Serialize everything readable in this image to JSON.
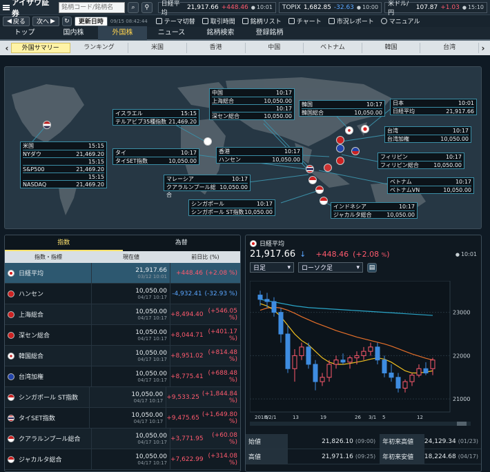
{
  "header": {
    "brand": "アイザワ証券",
    "search_placeholder": "銘柄コード/銘柄名",
    "indices": [
      {
        "name": "日経平均",
        "value": "21,917.66",
        "change": "+448.46",
        "time": "10:01",
        "dir": "up"
      },
      {
        "name": "TOPIX",
        "value": "1,682.85",
        "change": "-32.63",
        "time": "10:00",
        "dir": "dn"
      },
      {
        "name": "米ドル/円",
        "value": "107.87",
        "change": "+1.03",
        "time": "15:10",
        "dir": "up"
      }
    ]
  },
  "bar2": {
    "back": "戻る",
    "next": "次へ",
    "update": "更新日時",
    "stamp": "09/15 08:42:44",
    "tools": [
      "テーマ切替",
      "取引時間",
      "銘柄リスト",
      "チャート",
      "市況レポート",
      "マニュアル"
    ]
  },
  "maintabs": [
    "トップ",
    "国内株",
    "外国株",
    "ニュース",
    "銘柄検索",
    "登録銘柄"
  ],
  "subtabs": [
    "外国サマリー",
    "ランキング",
    "米国",
    "香港",
    "中国",
    "ベトナム",
    "韓国",
    "台湾"
  ],
  "map": {
    "boxes": [
      {
        "id": "china",
        "rows": [
          [
            "中国",
            "10:17"
          ],
          [
            "上海総合",
            "10,050.00"
          ],
          [
            "",
            "10:17"
          ],
          [
            "深セン総合",
            "10,050.00"
          ]
        ]
      },
      {
        "id": "korea",
        "rows": [
          [
            "韓国",
            "10:17"
          ],
          [
            "韓国総合",
            "10,050.00"
          ]
        ]
      },
      {
        "id": "japan",
        "rows": [
          [
            "日本",
            "10:01"
          ],
          [
            "日経平均",
            "21,917.66"
          ]
        ]
      },
      {
        "id": "israel",
        "rows": [
          [
            "イスラエル",
            "15:15"
          ],
          [
            "テルアビブ35種指数",
            "21,469.20"
          ]
        ]
      },
      {
        "id": "us",
        "rows": [
          [
            "米国",
            "15:15"
          ],
          [
            "NYダウ",
            "21,469.20"
          ],
          [
            "",
            "15:15"
          ],
          [
            "S&P500",
            "21,469.20"
          ],
          [
            "",
            "15:15"
          ],
          [
            "NASDAQ",
            "21,469.20"
          ]
        ]
      },
      {
        "id": "thai",
        "rows": [
          [
            "タイ",
            "10:17"
          ],
          [
            "タイSET指数",
            "10,050.00"
          ]
        ]
      },
      {
        "id": "hk",
        "rows": [
          [
            "香港",
            "10:17"
          ],
          [
            "ハンセン",
            "10,050.00"
          ]
        ]
      },
      {
        "id": "taiwan",
        "rows": [
          [
            "台湾",
            "10:17"
          ],
          [
            "台湾加権",
            "10,050.00"
          ]
        ]
      },
      {
        "id": "phil",
        "rows": [
          [
            "フィリピン",
            "10:17"
          ],
          [
            "フィリピン総合",
            "10,050.00"
          ]
        ]
      },
      {
        "id": "malay",
        "rows": [
          [
            "マレーシア",
            "10:17"
          ],
          [
            "クアラルンプール総合",
            "10,050.00"
          ]
        ]
      },
      {
        "id": "viet",
        "rows": [
          [
            "ベトナム",
            "10:17"
          ],
          [
            "ベトナムVN",
            "10,050.00"
          ]
        ]
      },
      {
        "id": "sing",
        "rows": [
          [
            "シンガポール",
            "10:17"
          ],
          [
            "シンガポール ST指数",
            "10,050.00"
          ]
        ]
      },
      {
        "id": "indo",
        "rows": [
          [
            "インドネシア",
            "10:17"
          ],
          [
            "ジャカルタ総合",
            "10,050.00"
          ]
        ]
      }
    ]
  },
  "left": {
    "tabs": [
      "指数",
      "為替"
    ],
    "headers": [
      "指数・指標",
      "現在値",
      "前日比 (%)"
    ],
    "rows": [
      {
        "name": "日経平均",
        "value": "21,917.66",
        "time": "03/12 10:01",
        "chg": "+448.46",
        "pct": "(+2.08 %)",
        "dir": "up",
        "flag": "jp"
      },
      {
        "name": "ハンセン",
        "value": "10,050.00",
        "time": "04/17 10:17",
        "chg": "-4,932.41",
        "pct": "(-32.93 %)",
        "dir": "dn",
        "flag": "hk"
      },
      {
        "name": "上海総合",
        "value": "10,050.00",
        "time": "04/17 10:17",
        "chg": "+8,494.40",
        "pct": "(+546.05 %)",
        "dir": "up",
        "flag": "cn"
      },
      {
        "name": "深セン総合",
        "value": "10,050.00",
        "time": "04/17 10:17",
        "chg": "+8,044.71",
        "pct": "(+401.17 %)",
        "dir": "up",
        "flag": "cn"
      },
      {
        "name": "韓国総合",
        "value": "10,050.00",
        "time": "04/17 10:17",
        "chg": "+8,951.02",
        "pct": "(+814.48 %)",
        "dir": "up",
        "flag": "kr"
      },
      {
        "name": "台湾加権",
        "value": "10,050.00",
        "time": "04/17 10:17",
        "chg": "+8,775.41",
        "pct": "(+688.48 %)",
        "dir": "up",
        "flag": "tw"
      },
      {
        "name": "シンガポール ST指数",
        "value": "10,050.00",
        "time": "04/17 10:17",
        "chg": "+9,533.25",
        "pct": "(+1,844.84 %)",
        "dir": "up",
        "flag": "sg"
      },
      {
        "name": "タイSET指数",
        "value": "10,050.00",
        "time": "04/17 10:17",
        "chg": "+9,475.65",
        "pct": "(+1,649.80 %)",
        "dir": "up",
        "flag": "th"
      },
      {
        "name": "クアラルンプール総合",
        "value": "10,050.00",
        "time": "04/17 10:17",
        "chg": "+3,771.95",
        "pct": "(+60.08 %)",
        "dir": "up",
        "flag": "my"
      },
      {
        "name": "ジャカルタ総合",
        "value": "10,050.00",
        "time": "04/17 10:17",
        "chg": "+7,622.99",
        "pct": "(+314.08 %)",
        "dir": "up",
        "flag": "id"
      }
    ]
  },
  "right": {
    "title": "日経平均",
    "price": "21,917.66",
    "arrow": "↓",
    "chg": "+448.46",
    "pct": "+2.08",
    "pct_unit": "%",
    "time": "10:01",
    "period": "日足",
    "ctype": "ローソク足",
    "chart_data": {
      "type": "candlestick",
      "y_ticks": [
        "23000",
        "22000",
        "21000"
      ],
      "ylim": [
        20700,
        23600
      ],
      "x_labels": [
        "2018/2/1",
        "5",
        "13",
        "19",
        "26",
        "3/1",
        "5",
        "12"
      ],
      "candles": [
        [
          23400,
          23500,
          23150,
          23300
        ],
        [
          23300,
          23450,
          23100,
          23250
        ],
        [
          23250,
          23350,
          22900,
          23000
        ],
        [
          23000,
          23100,
          22300,
          22500
        ],
        [
          22500,
          22700,
          21600,
          21700
        ],
        [
          21700,
          22150,
          21400,
          22000
        ],
        [
          22000,
          22300,
          21900,
          22200
        ],
        [
          22200,
          22300,
          21700,
          21800
        ],
        [
          21800,
          21900,
          21200,
          21400
        ],
        [
          21400,
          21600,
          21300,
          21500
        ],
        [
          21500,
          21900,
          21400,
          21800
        ],
        [
          21800,
          22000,
          21700,
          21900
        ],
        [
          21900,
          22050,
          21800,
          21850
        ],
        [
          21850,
          22000,
          21700,
          21950
        ],
        [
          21950,
          22100,
          21800,
          22000
        ],
        [
          22000,
          22200,
          21900,
          22100
        ],
        [
          22100,
          22300,
          22000,
          22200
        ],
        [
          22200,
          22300,
          21800,
          21900
        ],
        [
          21900,
          22000,
          21500,
          21600
        ],
        [
          21600,
          21800,
          21400,
          21500
        ],
        [
          21500,
          21600,
          21150,
          21250
        ],
        [
          21250,
          21450,
          21150,
          21400
        ],
        [
          21400,
          21600,
          21300,
          21550
        ],
        [
          21550,
          21800,
          21500,
          21700
        ],
        [
          21700,
          21850,
          21550,
          21600
        ],
        [
          21700,
          21950,
          21550,
          21900
        ]
      ],
      "ma1": [
        23200,
        23150,
        23050,
        22900,
        22700,
        22500,
        22350,
        22250,
        22100,
        21950,
        21850,
        21800,
        21800,
        21820,
        21850,
        21880,
        21920,
        21950,
        21920,
        21850,
        21750,
        21650,
        21600,
        21600,
        21620,
        21650
      ],
      "ma2": [
        23050,
        23100,
        23120,
        23100,
        23050,
        22980,
        22900,
        22830,
        22760,
        22700,
        22640,
        22580,
        22530,
        22480,
        22430,
        22390,
        22350,
        22310,
        22270,
        22220,
        22160,
        22100,
        22040,
        21990,
        21940,
        21900
      ],
      "ma3": [
        23300,
        23270,
        23240,
        23210,
        23180,
        23150,
        23130,
        23110,
        23100,
        23090,
        23080,
        23070,
        23060,
        23050,
        23040,
        23030,
        23020,
        23010,
        23000,
        22990,
        22980,
        22970,
        22960,
        22950,
        22940,
        22930
      ]
    }
  },
  "stats": [
    {
      "l": "始値",
      "v": "21,826.10",
      "t": "(09:00)",
      "l2": "年初来高値",
      "v2": "24,129.34",
      "t2": "(01/23)"
    },
    {
      "l": "高値",
      "v": "21,971.16",
      "t": "(09:25)",
      "l2": "年初来安値",
      "v2": "18,224.68",
      "t2": "(04/17)"
    }
  ],
  "colors": {
    "up": "#ff5a6e",
    "dn": "#5aa6ff",
    "accent": "#ffd34d"
  }
}
